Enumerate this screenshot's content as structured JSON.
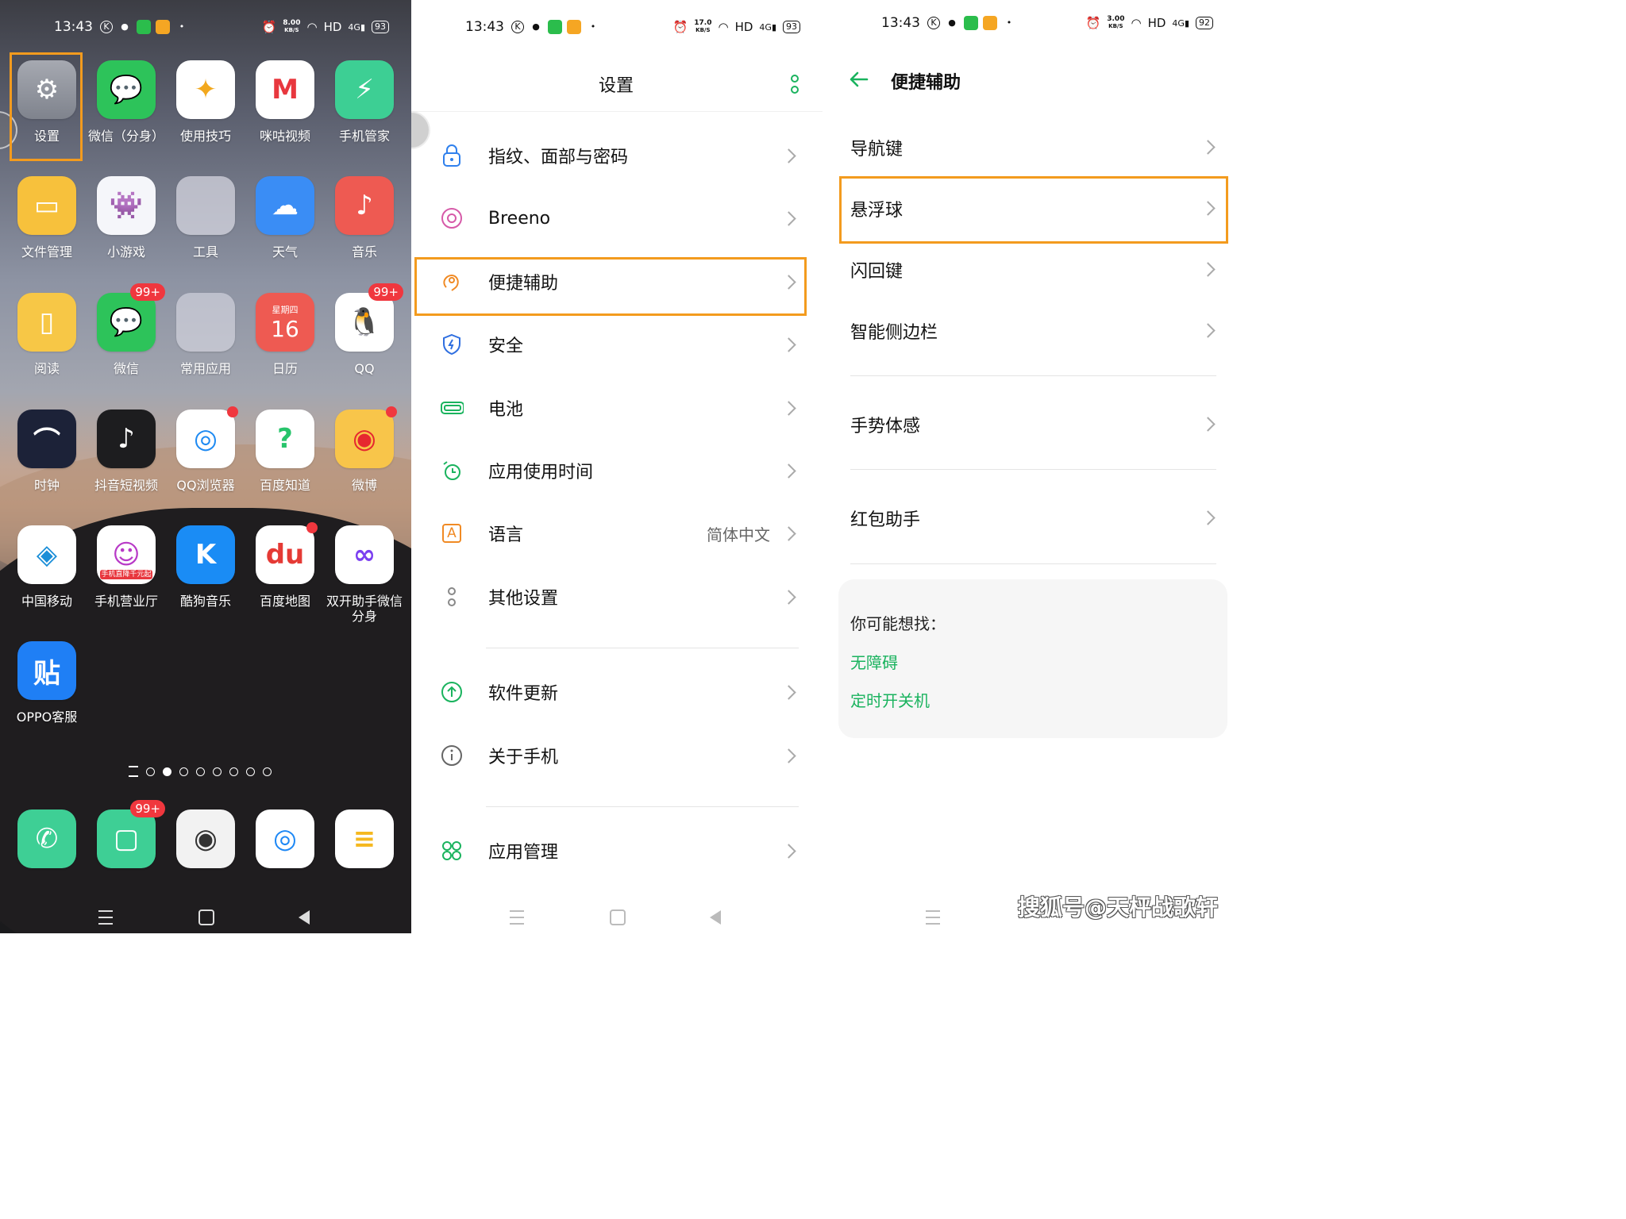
{
  "colors": {
    "accent": "#1ab35e",
    "highlight": "#f39b1e",
    "badge": "#f0373e"
  },
  "statusbar": [
    {
      "time": "13:43",
      "speed_top": "8.00",
      "speed_unit": "KB/S",
      "hd": "HD",
      "net": "4G",
      "battery": "93"
    },
    {
      "time": "13:43",
      "speed_top": "17.0",
      "speed_unit": "KB/S",
      "hd": "HD",
      "net": "4G",
      "battery": "93"
    },
    {
      "time": "13:43",
      "speed_top": "3.00",
      "speed_unit": "KB/S",
      "hd": "HD",
      "net": "4G",
      "battery": "92"
    }
  ],
  "home": {
    "apps": [
      {
        "label": "设置",
        "icon": "settings-gear-icon"
      },
      {
        "label": "微信（分身）",
        "icon": "wechat-clone-icon"
      },
      {
        "label": "使用技巧",
        "icon": "tips-signpost-icon"
      },
      {
        "label": "咪咕视频",
        "icon": "migu-video-icon"
      },
      {
        "label": "手机管家",
        "icon": "phone-manager-shield-icon"
      },
      {
        "label": "文件管理",
        "icon": "folder-icon"
      },
      {
        "label": "小游戏",
        "icon": "mini-games-icon"
      },
      {
        "label": "工具",
        "icon": "tools-folder-icon"
      },
      {
        "label": "天气",
        "icon": "weather-icon"
      },
      {
        "label": "音乐",
        "icon": "music-icon"
      },
      {
        "label": "阅读",
        "icon": "book-icon"
      },
      {
        "label": "微信",
        "icon": "wechat-icon",
        "badge": "99+"
      },
      {
        "label": "常用应用",
        "icon": "common-apps-folder-icon"
      },
      {
        "label": "日历",
        "icon": "calendar-icon",
        "weekday": "星期四",
        "day": "16"
      },
      {
        "label": "QQ",
        "icon": "qq-penguin-icon",
        "badge": "99+"
      },
      {
        "label": "时钟",
        "icon": "clock-icon"
      },
      {
        "label": "抖音短视频",
        "icon": "douyin-icon"
      },
      {
        "label": "QQ浏览器",
        "icon": "qq-browser-icon"
      },
      {
        "label": "百度知道",
        "icon": "baidu-zhidao-icon"
      },
      {
        "label": "微博",
        "icon": "weibo-icon"
      },
      {
        "label": "中国移动",
        "icon": "china-mobile-icon"
      },
      {
        "label": "手机营业厅",
        "icon": "mobile-hall-icon",
        "banner": "手机直降千元起"
      },
      {
        "label": "酷狗音乐",
        "icon": "kugou-icon",
        "glyph": "K"
      },
      {
        "label": "百度地图",
        "icon": "baidu-map-icon",
        "glyph": "du"
      },
      {
        "label": "双开助手微信分身",
        "icon": "dual-app-icon"
      },
      {
        "label": "OPPO客服",
        "icon": "oppo-service-icon",
        "glyph": "贴"
      }
    ],
    "dock": [
      {
        "icon": "phone-icon"
      },
      {
        "icon": "messages-icon",
        "badge": "99+"
      },
      {
        "icon": "camera-icon"
      },
      {
        "icon": "browser-icon"
      },
      {
        "icon": "notes-icon"
      }
    ],
    "pages": 8,
    "current_page": 1
  },
  "settings": {
    "title": "设置",
    "items": [
      {
        "label": "指纹、面部与密码",
        "icon": "lock-icon"
      },
      {
        "label": "Breeno",
        "icon": "breeno-icon"
      },
      {
        "label": "便捷辅助",
        "icon": "accessibility-hand-icon"
      },
      {
        "label": "安全",
        "icon": "security-shield-icon"
      },
      {
        "label": "电池",
        "icon": "battery-icon"
      },
      {
        "label": "应用使用时间",
        "icon": "screen-time-icon"
      },
      {
        "label": "语言",
        "icon": "language-icon",
        "value": "简体中文",
        "glyph": "A"
      },
      {
        "label": "其他设置",
        "icon": "other-settings-icon"
      },
      {
        "label": "软件更新",
        "icon": "update-arrow-icon"
      },
      {
        "label": "关于手机",
        "icon": "info-icon"
      },
      {
        "label": "应用管理",
        "icon": "app-management-icon"
      }
    ]
  },
  "convenience": {
    "title": "便捷辅助",
    "items": [
      "导航键",
      "悬浮球",
      "闪回键",
      "智能侧边栏",
      "手势体感",
      "红包助手"
    ],
    "suggest_title": "你可能想找：",
    "suggest_links": [
      "无障碍",
      "定时开关机"
    ]
  },
  "watermark": "搜狐号@天枰战歌轩"
}
